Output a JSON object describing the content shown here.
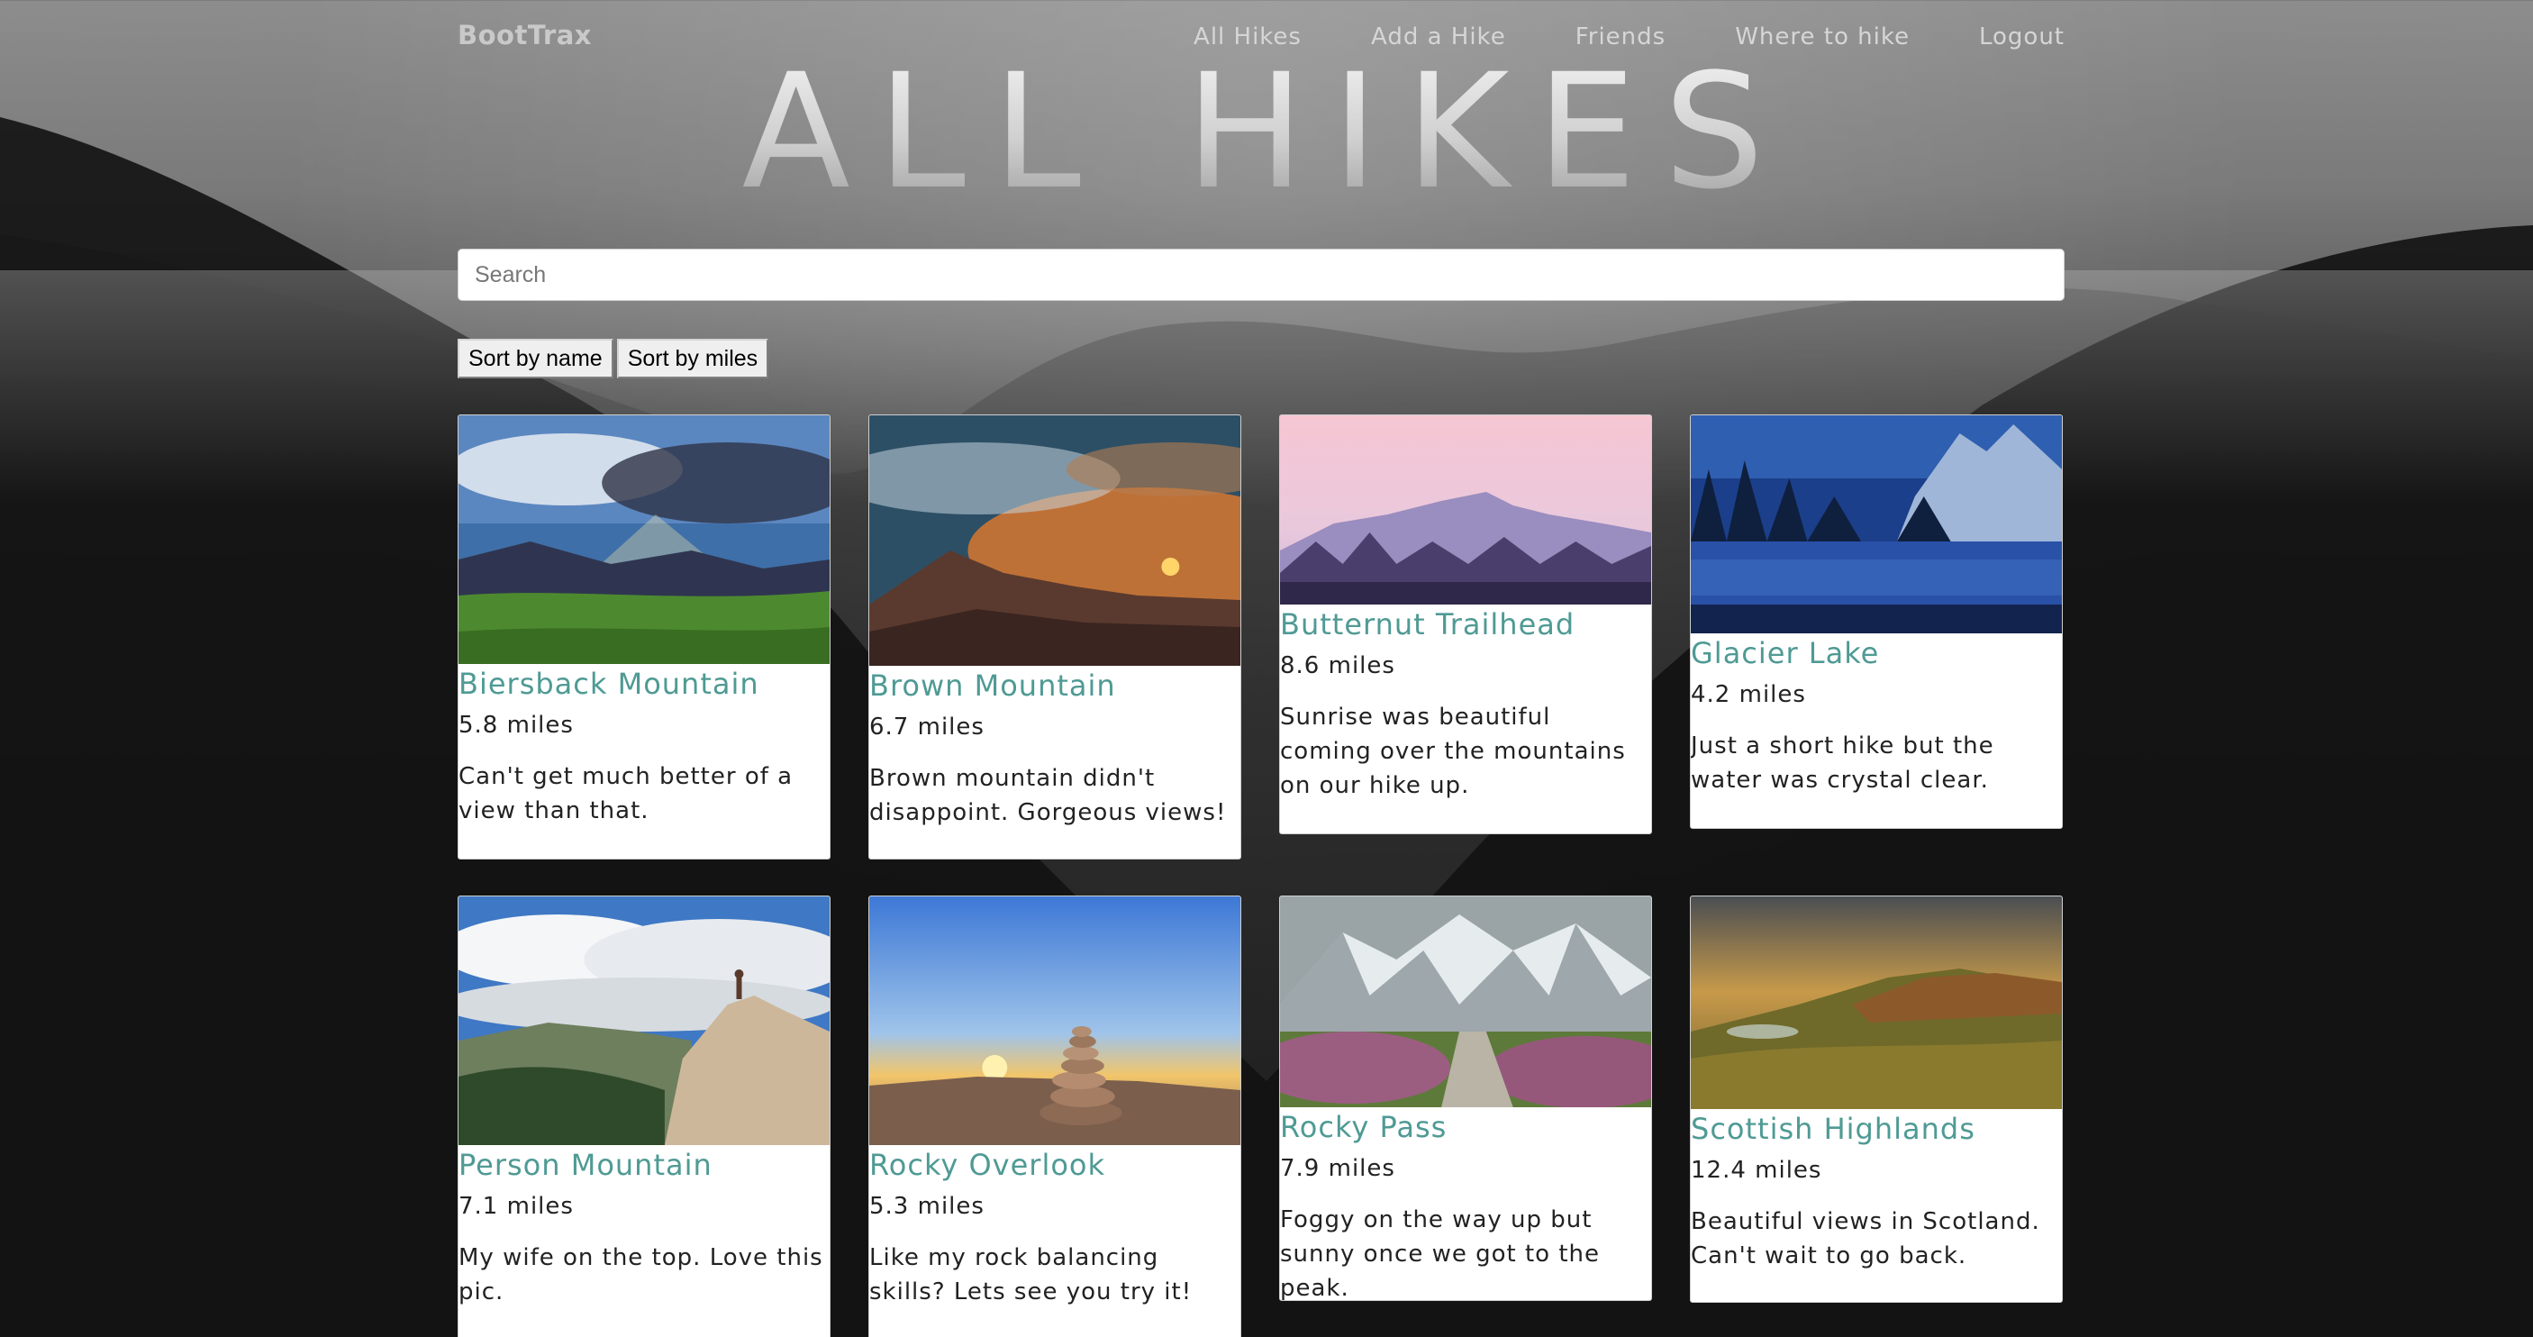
{
  "nav": {
    "brand": "BootTrax",
    "links": [
      "All Hikes",
      "Add a Hike",
      "Friends",
      "Where to hike",
      "Logout"
    ]
  },
  "hero": {
    "title": "ALL HIKES"
  },
  "search": {
    "placeholder": "Search",
    "value": ""
  },
  "sort": {
    "by_name": "Sort by name",
    "by_miles": "Sort by miles"
  },
  "hikes": [
    {
      "name": "Biersback Mountain",
      "miles": "5.8 miles",
      "description": "Can't get much better of a view than that.",
      "photo_icon": "mountain-sunrays-photo"
    },
    {
      "name": "Brown Mountain",
      "miles": "6.7 miles",
      "description": "Brown mountain didn't disappoint. Gorgeous views!",
      "photo_icon": "mountain-sunset-photo"
    },
    {
      "name": "Butternut Trailhead",
      "miles": "8.6 miles",
      "description": "Sunrise was beautiful coming over the mountains on our hike up.",
      "photo_icon": "pink-sky-mountains-photo"
    },
    {
      "name": "Glacier Lake",
      "miles": "4.2 miles",
      "description": "Just a short hike but the water was crystal clear.",
      "photo_icon": "blue-lake-photo"
    },
    {
      "name": "Person Mountain",
      "miles": "7.1 miles",
      "description": "My wife on the top. Love this pic.",
      "photo_icon": "cliff-summit-photo"
    },
    {
      "name": "Rocky Overlook",
      "miles": "5.3 miles",
      "description": "Like my rock balancing skills? Lets see you try it!",
      "photo_icon": "rock-cairn-photo"
    },
    {
      "name": "Rocky Pass",
      "miles": "7.9 miles",
      "description": "Foggy on the way up but sunny once we got to the peak.",
      "photo_icon": "stone-path-photo"
    },
    {
      "name": "Scottish Highlands",
      "miles": "12.4 miles",
      "description": "Beautiful views in Scotland. Can't wait to go back.",
      "photo_icon": "highlands-photo"
    }
  ],
  "colors": {
    "accent": "#4f9a94",
    "card_bg": "#ffffff",
    "text": "#222222"
  }
}
